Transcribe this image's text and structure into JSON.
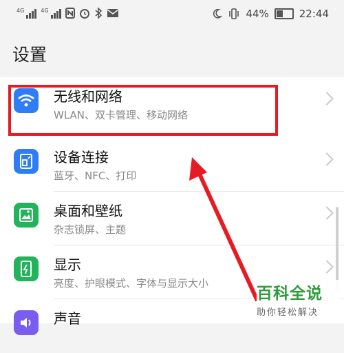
{
  "status_bar": {
    "signal_tag_1": "4G",
    "signal_tag_2": "4G",
    "battery": "44%",
    "time": "22:44"
  },
  "page_title": "设置",
  "settings": [
    {
      "label": "无线和网络",
      "sub": "WLAN、双卡管理、移动网络",
      "icon": "wifi-icon",
      "color": "#2f7df6"
    },
    {
      "label": "设备连接",
      "sub": "蓝牙、NFC、打印",
      "icon": "device-connection-icon",
      "color": "#2f7df6"
    },
    {
      "label": "桌面和壁纸",
      "sub": "杂志锁屏、主题",
      "icon": "wallpaper-icon",
      "color": "#22b45a"
    },
    {
      "label": "显示",
      "sub": "亮度、护眼模式、字体与显示大小",
      "icon": "display-icon",
      "color": "#22b45a"
    },
    {
      "label": "声音",
      "sub": "",
      "icon": "sound-icon",
      "color": "#7a5cf0"
    }
  ],
  "watermark": {
    "title": "百科全说",
    "subtitle": "助你轻松解决"
  },
  "colors": {
    "highlight": "#e51c23",
    "arrow": "#e51c23"
  }
}
